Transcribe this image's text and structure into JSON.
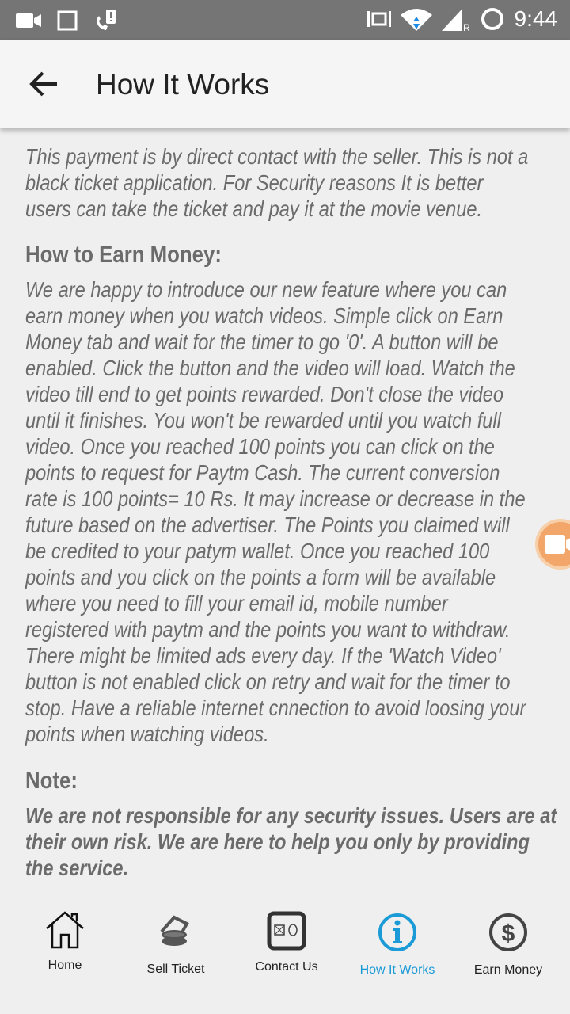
{
  "status_bar": {
    "time": "9:44",
    "icons": [
      "video-icon",
      "tablet-icon",
      "missed-call-icon",
      "vibrate-icon",
      "wifi-icon",
      "signal-roaming-icon",
      "battery-ring-icon"
    ]
  },
  "header": {
    "title": "How It Works"
  },
  "content": {
    "intro_lines": [
      "This payment is by direct contact with the seller. This is not a",
      "black ticket application. For Security reasons It is better",
      "users can take the ticket and pay it at the movie venue."
    ],
    "earn_heading": "How to Earn Money:",
    "earn_lines": [
      "We are happy to introduce our new feature where you can",
      "earn money when you watch videos. Simple click on Earn",
      "Money tab and wait for the timer to go '0'. A button will be",
      "enabled. Click the button and the video will load. Watch the",
      "video till end to get points rewarded. Don't close the video",
      "until it finishes. You won't be rewarded until you watch full",
      "video. Once you reached 100 points you can click on the",
      "points to request for Paytm Cash. The current conversion",
      "rate is 100 points= 10 Rs. It may increase or decrease in the",
      "future based on the advertiser. The Points you claimed will",
      "be credited to your patym wallet. Once you reached 100",
      "points and you click on the points a form will be available",
      "where you need to fill your email id, mobile number",
      "registered with paytm and the points you want to withdraw.",
      "There might be limited ads every day. If the 'Watch Video'",
      "button is not enabled click on retry and wait for the timer to",
      "stop. Have a reliable internet cnnection to avoid loosing your",
      "points when watching videos."
    ],
    "note_heading": "Note:",
    "note_lines": [
      "We are not responsible for any security issues. Users are at",
      "their own risk. We are here to help you only by providing",
      "the service."
    ]
  },
  "nav": {
    "active_color": "#1a9ad6",
    "items": [
      {
        "label": "Home"
      },
      {
        "label": "Sell Ticket"
      },
      {
        "label": "Contact Us"
      },
      {
        "label": "How It Works",
        "active": true
      },
      {
        "label": "Earn Money"
      }
    ]
  }
}
